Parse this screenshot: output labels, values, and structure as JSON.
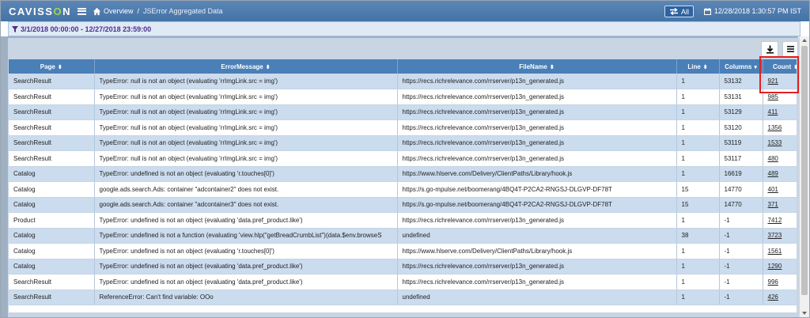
{
  "header": {
    "logo_left": "CAVISS",
    "logo_o": "O",
    "logo_right": "N",
    "breadcrumb_home": "Overview",
    "breadcrumb_sep": "/",
    "breadcrumb_current": "JSError Aggregated Data",
    "all_button": "All",
    "datetime": "12/28/2018 1:30:57 PM IST"
  },
  "filter": {
    "range": "3/1/2018 00:00:00 - 12/27/2018 23:59:00"
  },
  "toolbar": {
    "download_icon": "download-icon",
    "columns_icon": "list-icon"
  },
  "table": {
    "columns": [
      {
        "label": "Page",
        "sort": "⬍"
      },
      {
        "label": "ErrorMessage",
        "sort": "⬍"
      },
      {
        "label": "FileName",
        "sort": "⬍"
      },
      {
        "label": "Line",
        "sort": "⬍"
      },
      {
        "label": "Columns",
        "sort": "▾"
      },
      {
        "label": "Count",
        "sort": "⬍"
      }
    ],
    "rows": [
      [
        "SearchResult",
        "TypeError: null is not an object (evaluating 'rrImgLink.src = img')",
        "https://recs.richrelevance.com/rrserver/p13n_generated.js",
        "1",
        "53132",
        "921"
      ],
      [
        "SearchResult",
        "TypeError: null is not an object (evaluating 'rrImgLink.src = img')",
        "https://recs.richrelevance.com/rrserver/p13n_generated.js",
        "1",
        "53131",
        "985"
      ],
      [
        "SearchResult",
        "TypeError: null is not an object (evaluating 'rrImgLink.src = img')",
        "https://recs.richrelevance.com/rrserver/p13n_generated.js",
        "1",
        "53129",
        "411"
      ],
      [
        "SearchResult",
        "TypeError: null is not an object (evaluating 'rrImgLink.src = img')",
        "https://recs.richrelevance.com/rrserver/p13n_generated.js",
        "1",
        "53120",
        "1356"
      ],
      [
        "SearchResult",
        "TypeError: null is not an object (evaluating 'rrImgLink.src = img')",
        "https://recs.richrelevance.com/rrserver/p13n_generated.js",
        "1",
        "53119",
        "1533"
      ],
      [
        "SearchResult",
        "TypeError: null is not an object (evaluating 'rrImgLink.src = img')",
        "https://recs.richrelevance.com/rrserver/p13n_generated.js",
        "1",
        "53117",
        "480"
      ],
      [
        "Catalog",
        "TypeError: undefined is not an object (evaluating 'r.touches[0]')",
        "https://www.hlserve.com/Delivery/ClientPaths/Library/hook.js",
        "1",
        "16619",
        "489"
      ],
      [
        "Catalog",
        "google.ads.search.Ads: container \"adcontainer2\" does not exist.",
        "https://s.go-mpulse.net/boomerang/4BQ4T-P2CA2-RNGSJ-DLGVP-DF78T",
        "15",
        "14770",
        "401"
      ],
      [
        "Catalog",
        "google.ads.search.Ads: container \"adcontainer3\" does not exist.",
        "https://s.go-mpulse.net/boomerang/4BQ4T-P2CA2-RNGSJ-DLGVP-DF78T",
        "15",
        "14770",
        "371"
      ],
      [
        "Product",
        "TypeError: undefined is not an object (evaluating 'data.pref_product.like')",
        "https://recs.richrelevance.com/rrserver/p13n_generated.js",
        "1",
        "-1",
        "7412"
      ],
      [
        "Catalog",
        "TypeError: undefined is not a function (evaluating 'view.hlp(\"getBreadCrumbList\")(data.$env.browseS",
        "undefined",
        "38",
        "-1",
        "3723"
      ],
      [
        "Catalog",
        "TypeError: undefined is not an object (evaluating 'r.touches[0]')",
        "https://www.hlserve.com/Delivery/ClientPaths/Library/hook.js",
        "1",
        "-1",
        "1561"
      ],
      [
        "Catalog",
        "TypeError: undefined is not an object (evaluating 'data.pref_product.like')",
        "https://recs.richrelevance.com/rrserver/p13n_generated.js",
        "1",
        "-1",
        "1290"
      ],
      [
        "SearchResult",
        "TypeError: undefined is not an object (evaluating 'data.pref_product.like')",
        "https://recs.richrelevance.com/rrserver/p13n_generated.js",
        "1",
        "-1",
        "996"
      ],
      [
        "SearchResult",
        "ReferenceError: Can't find variable: OOo",
        "undefined",
        "1",
        "-1",
        "426"
      ]
    ]
  },
  "colors": {
    "topbar": "#4f7caf",
    "header_row": "#4a7fb8",
    "odd_row": "#cbdcee",
    "filter_text": "#4b2f8c",
    "highlight": "#e02020"
  }
}
